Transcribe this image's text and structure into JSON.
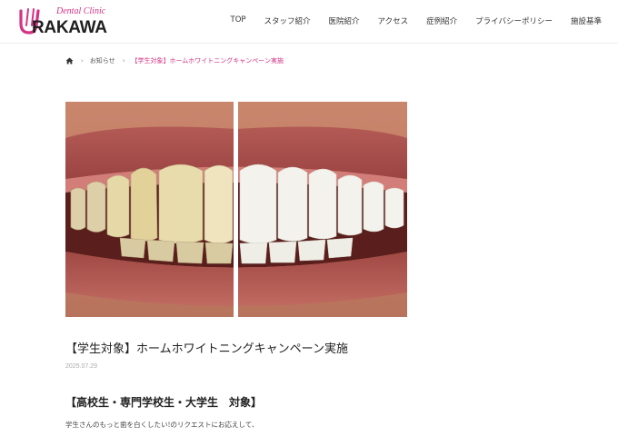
{
  "header": {
    "logo_text": "RAKAWA",
    "logo_subtitle": "Dental Clinic",
    "brand_color": "#d63384"
  },
  "nav": {
    "items": [
      {
        "label": "TOP"
      },
      {
        "label": "スタッフ紹介"
      },
      {
        "label": "医院紹介"
      },
      {
        "label": "アクセス"
      },
      {
        "label": "症例紹介"
      },
      {
        "label": "プライバシーポリシー"
      },
      {
        "label": "施設基準"
      }
    ]
  },
  "breadcrumb": {
    "home_icon": "home-icon",
    "items": [
      {
        "label": "お知らせ"
      },
      {
        "label": "【学生対象】ホームホワイトニングキャンペーン実施"
      }
    ]
  },
  "hero_image": {
    "description_icon": "teeth-before-after-image"
  },
  "post": {
    "title": "【学生対象】ホームホワイトニングキャンペーン実施",
    "date": "2025.07.29",
    "section_heading": "【高校生・専門学校生・大学生　対象】",
    "body_first_line": "学生さんのもっと歯を白くしたい!のリクエストにお応えして、"
  }
}
